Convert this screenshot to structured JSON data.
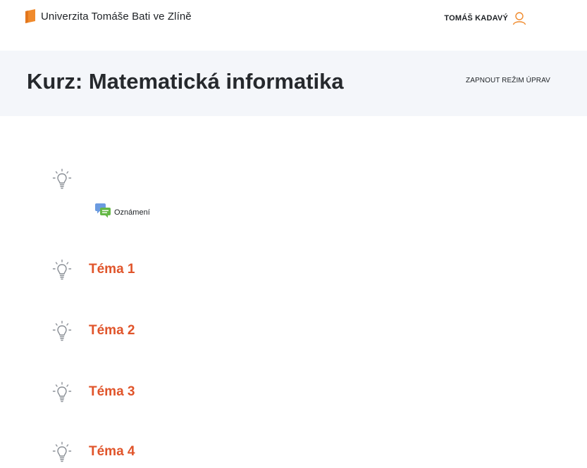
{
  "navbar": {
    "site_name": "Univerzita Tomáše Bati ve Zlíně",
    "user_name": "TOMÁŠ KADAVÝ"
  },
  "course": {
    "title": "Kurz: Matematická informatika",
    "edit_mode_label": "ZAPNOUT REŽIM ÚPRAV"
  },
  "general_section": {
    "activities": [
      {
        "label": "Oznámení",
        "icon": "forum-icon"
      }
    ]
  },
  "sections": [
    {
      "title": "Téma 1",
      "icon": "lightbulb-icon"
    },
    {
      "title": "Téma 2",
      "icon": "lightbulb-icon"
    },
    {
      "title": "Téma 3",
      "icon": "lightbulb-icon"
    },
    {
      "title": "Téma 4",
      "icon": "lightbulb-icon"
    }
  ],
  "colors": {
    "brand_orange": "#f08a2c",
    "section_link": "#e0542a",
    "header_band": "#f4f6fa"
  }
}
